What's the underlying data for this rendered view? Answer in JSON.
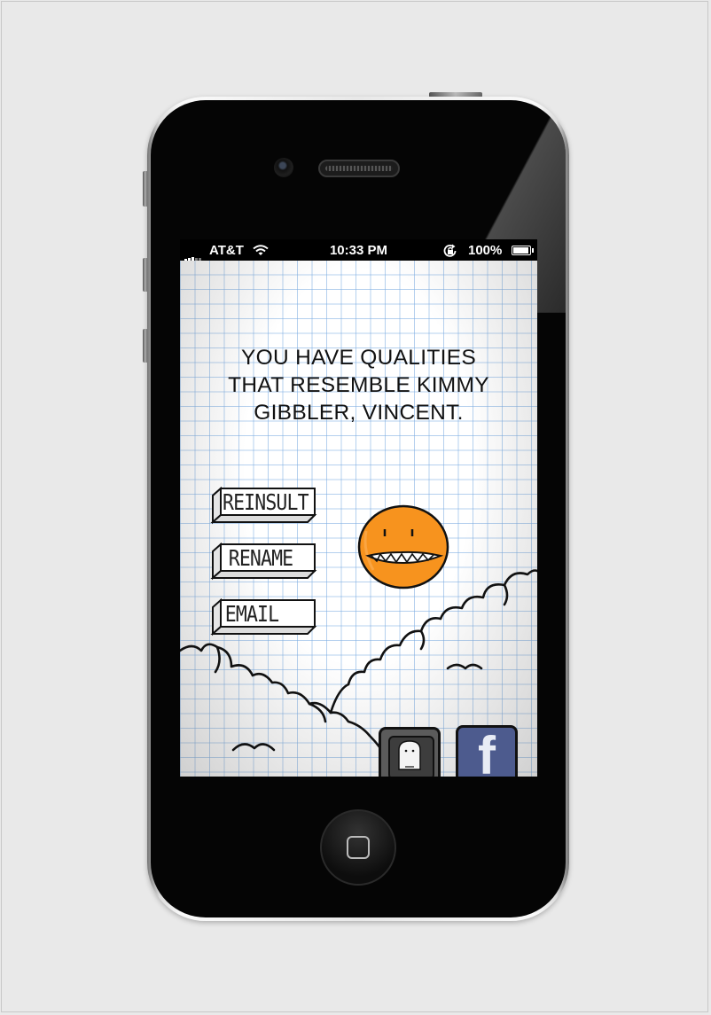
{
  "status_bar": {
    "carrier": "AT&T",
    "time": "10:33 PM",
    "battery": "100%",
    "battery_level": 1.0,
    "signal_icon": "signal-bars-icon",
    "wifi_icon": "wifi-icon",
    "rotation_lock_icon": "rotation-lock-icon",
    "battery_icon": "battery-icon"
  },
  "headline": {
    "line1": "YOU HAVE QUALITIES",
    "line2": "THAT RESEMBLE KIMMY",
    "line3": "GIBBLER, VINCENT."
  },
  "buttons": {
    "reinsult": "REINSULT",
    "rename": "RENAME",
    "email": "EMAIL"
  },
  "share": {
    "ghost_icon": "ghost-app-icon",
    "facebook_icon": "facebook-icon",
    "facebook_letter": "f"
  },
  "colors": {
    "monster": "#f7931e",
    "facebook": "#4d5b8e",
    "grid": "#78aae1"
  }
}
